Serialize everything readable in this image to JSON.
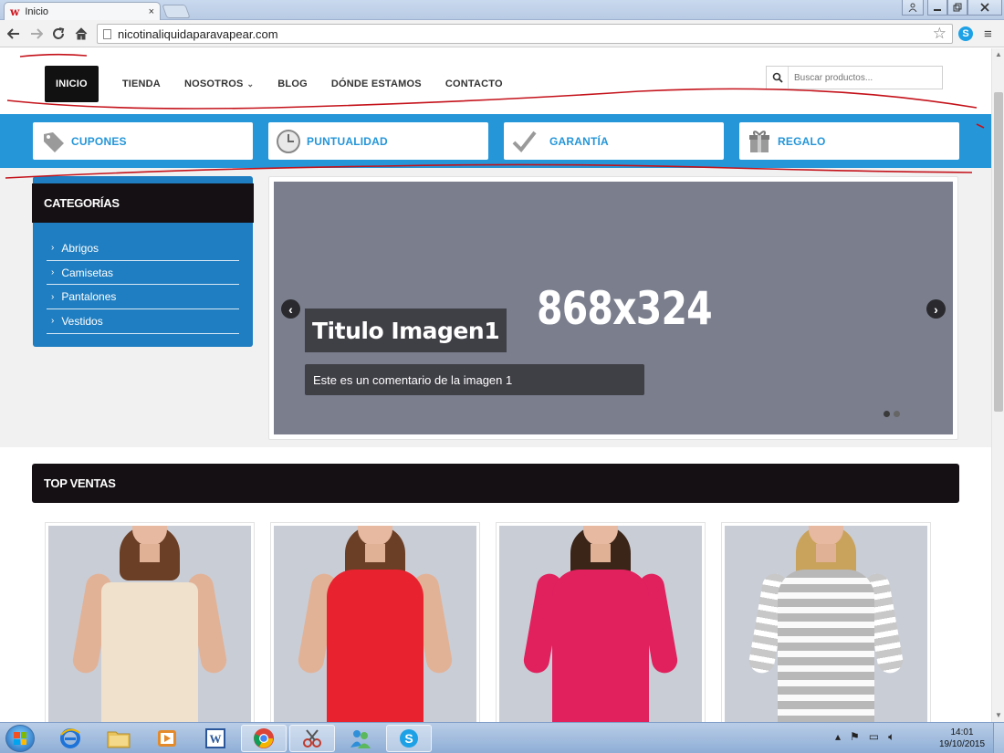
{
  "browser": {
    "tab_title": "Inicio",
    "tab_close": "×",
    "favicon": "w",
    "url": "nicotinaliquidaparavapear.com",
    "skype": "S"
  },
  "site": {
    "nav": [
      {
        "label": "INICIO",
        "active": true
      },
      {
        "label": "TIENDA"
      },
      {
        "label": "NOSOTROS"
      },
      {
        "label": "BLOG"
      },
      {
        "label": "DÓNDE ESTAMOS"
      },
      {
        "label": "CONTACTO"
      }
    ],
    "search_placeholder": "Buscar productos...",
    "features": [
      {
        "label": "CUPONES",
        "icon": "tag-icon"
      },
      {
        "label": "PUNTUALIDAD",
        "icon": "clock-icon"
      },
      {
        "label": "GARANTÍA",
        "icon": "checkmark-icon"
      },
      {
        "label": "REGALO",
        "icon": "gift-icon"
      }
    ],
    "categories_title": "CATEGORÍAS",
    "categories": [
      "Abrigos",
      "Camisetas",
      "Pantalones",
      "Vestidos"
    ],
    "slider": {
      "dims": "868x324",
      "caption_title": "Titulo Imagen1",
      "caption_text": "Este es un comentario de la imagen 1",
      "prev": "‹",
      "next": "›",
      "slides": 2,
      "current": 1
    },
    "top_ventas_title": "TOP VENTAS",
    "products": [
      {
        "color": "#efe1cc"
      },
      {
        "color": "#e8232f"
      },
      {
        "color": "#e0215e"
      },
      {
        "color": "#b8b8b8"
      }
    ]
  },
  "taskbar": {
    "time": "14:01",
    "date": "19/10/2015"
  },
  "colors": {
    "accent": "#2596d8",
    "dark": "#151014",
    "category_blue": "#1f7ec1",
    "annotation_red": "#c4121a"
  }
}
